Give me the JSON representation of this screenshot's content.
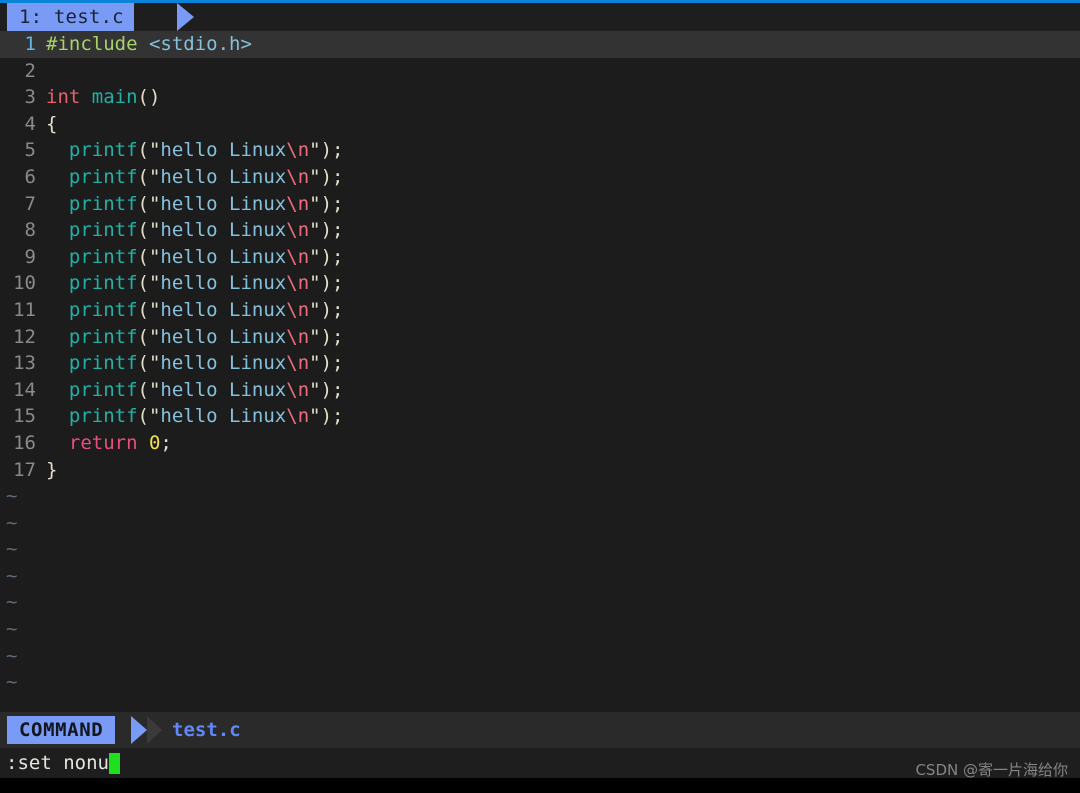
{
  "app": {
    "name": "vim",
    "accent_blue": "#7a9bf5",
    "top_strip_color": "#0a84d8",
    "background": "#1c1c1c",
    "cursorline_background": "#333333",
    "cursor_color": "#1fe01f"
  },
  "tabline": {
    "tabs": [
      {
        "label": "1: test.c",
        "active": true
      }
    ]
  },
  "editor": {
    "filename": "test.c",
    "cursor_line": 1,
    "lines": [
      {
        "num": "1",
        "tokens": [
          {
            "t": "#include ",
            "c": "c-pre"
          },
          {
            "t": "<stdio.h>",
            "c": "c-inc"
          }
        ]
      },
      {
        "num": "2",
        "tokens": []
      },
      {
        "num": "3",
        "tokens": [
          {
            "t": "int ",
            "c": "c-type"
          },
          {
            "t": "main",
            "c": "c-func"
          },
          {
            "t": "()",
            "c": "c-punct"
          }
        ]
      },
      {
        "num": "4",
        "tokens": [
          {
            "t": "{",
            "c": "c-punct"
          }
        ]
      },
      {
        "num": "5",
        "tokens": [
          {
            "t": "  ",
            "c": "c-punct"
          },
          {
            "t": "printf",
            "c": "c-func"
          },
          {
            "t": "(\"",
            "c": "c-punct"
          },
          {
            "t": "hello Linux",
            "c": "c-str"
          },
          {
            "t": "\\n",
            "c": "c-esc"
          },
          {
            "t": "\");",
            "c": "c-punct"
          }
        ]
      },
      {
        "num": "6",
        "tokens": [
          {
            "t": "  ",
            "c": "c-punct"
          },
          {
            "t": "printf",
            "c": "c-func"
          },
          {
            "t": "(\"",
            "c": "c-punct"
          },
          {
            "t": "hello Linux",
            "c": "c-str"
          },
          {
            "t": "\\n",
            "c": "c-esc"
          },
          {
            "t": "\");",
            "c": "c-punct"
          }
        ]
      },
      {
        "num": "7",
        "tokens": [
          {
            "t": "  ",
            "c": "c-punct"
          },
          {
            "t": "printf",
            "c": "c-func"
          },
          {
            "t": "(\"",
            "c": "c-punct"
          },
          {
            "t": "hello Linux",
            "c": "c-str"
          },
          {
            "t": "\\n",
            "c": "c-esc"
          },
          {
            "t": "\");",
            "c": "c-punct"
          }
        ]
      },
      {
        "num": "8",
        "tokens": [
          {
            "t": "  ",
            "c": "c-punct"
          },
          {
            "t": "printf",
            "c": "c-func"
          },
          {
            "t": "(\"",
            "c": "c-punct"
          },
          {
            "t": "hello Linux",
            "c": "c-str"
          },
          {
            "t": "\\n",
            "c": "c-esc"
          },
          {
            "t": "\");",
            "c": "c-punct"
          }
        ]
      },
      {
        "num": "9",
        "tokens": [
          {
            "t": "  ",
            "c": "c-punct"
          },
          {
            "t": "printf",
            "c": "c-func"
          },
          {
            "t": "(\"",
            "c": "c-punct"
          },
          {
            "t": "hello Linux",
            "c": "c-str"
          },
          {
            "t": "\\n",
            "c": "c-esc"
          },
          {
            "t": "\");",
            "c": "c-punct"
          }
        ]
      },
      {
        "num": "10",
        "tokens": [
          {
            "t": "  ",
            "c": "c-punct"
          },
          {
            "t": "printf",
            "c": "c-func"
          },
          {
            "t": "(\"",
            "c": "c-punct"
          },
          {
            "t": "hello Linux",
            "c": "c-str"
          },
          {
            "t": "\\n",
            "c": "c-esc"
          },
          {
            "t": "\");",
            "c": "c-punct"
          }
        ]
      },
      {
        "num": "11",
        "tokens": [
          {
            "t": "  ",
            "c": "c-punct"
          },
          {
            "t": "printf",
            "c": "c-func"
          },
          {
            "t": "(\"",
            "c": "c-punct"
          },
          {
            "t": "hello Linux",
            "c": "c-str"
          },
          {
            "t": "\\n",
            "c": "c-esc"
          },
          {
            "t": "\");",
            "c": "c-punct"
          }
        ]
      },
      {
        "num": "12",
        "tokens": [
          {
            "t": "  ",
            "c": "c-punct"
          },
          {
            "t": "printf",
            "c": "c-func"
          },
          {
            "t": "(\"",
            "c": "c-punct"
          },
          {
            "t": "hello Linux",
            "c": "c-str"
          },
          {
            "t": "\\n",
            "c": "c-esc"
          },
          {
            "t": "\");",
            "c": "c-punct"
          }
        ]
      },
      {
        "num": "13",
        "tokens": [
          {
            "t": "  ",
            "c": "c-punct"
          },
          {
            "t": "printf",
            "c": "c-func"
          },
          {
            "t": "(\"",
            "c": "c-punct"
          },
          {
            "t": "hello Linux",
            "c": "c-str"
          },
          {
            "t": "\\n",
            "c": "c-esc"
          },
          {
            "t": "\");",
            "c": "c-punct"
          }
        ]
      },
      {
        "num": "14",
        "tokens": [
          {
            "t": "  ",
            "c": "c-punct"
          },
          {
            "t": "printf",
            "c": "c-func"
          },
          {
            "t": "(\"",
            "c": "c-punct"
          },
          {
            "t": "hello Linux",
            "c": "c-str"
          },
          {
            "t": "\\n",
            "c": "c-esc"
          },
          {
            "t": "\");",
            "c": "c-punct"
          }
        ]
      },
      {
        "num": "15",
        "tokens": [
          {
            "t": "  ",
            "c": "c-punct"
          },
          {
            "t": "printf",
            "c": "c-func"
          },
          {
            "t": "(\"",
            "c": "c-punct"
          },
          {
            "t": "hello Linux",
            "c": "c-str"
          },
          {
            "t": "\\n",
            "c": "c-esc"
          },
          {
            "t": "\");",
            "c": "c-punct"
          }
        ]
      },
      {
        "num": "16",
        "tokens": [
          {
            "t": "  ",
            "c": "c-punct"
          },
          {
            "t": "return ",
            "c": "c-kw"
          },
          {
            "t": "0",
            "c": "c-num"
          },
          {
            "t": ";",
            "c": "c-punct"
          }
        ]
      },
      {
        "num": "17",
        "tokens": [
          {
            "t": "}",
            "c": "c-punct"
          }
        ]
      }
    ],
    "filler_marker": "~",
    "filler_count": 8
  },
  "statusline": {
    "mode": "COMMAND",
    "filename": "test.c"
  },
  "cmdline": {
    "text": ":set nonu",
    "cursor_visible": true
  },
  "watermark": {
    "text": "CSDN @寄一片海给你"
  }
}
